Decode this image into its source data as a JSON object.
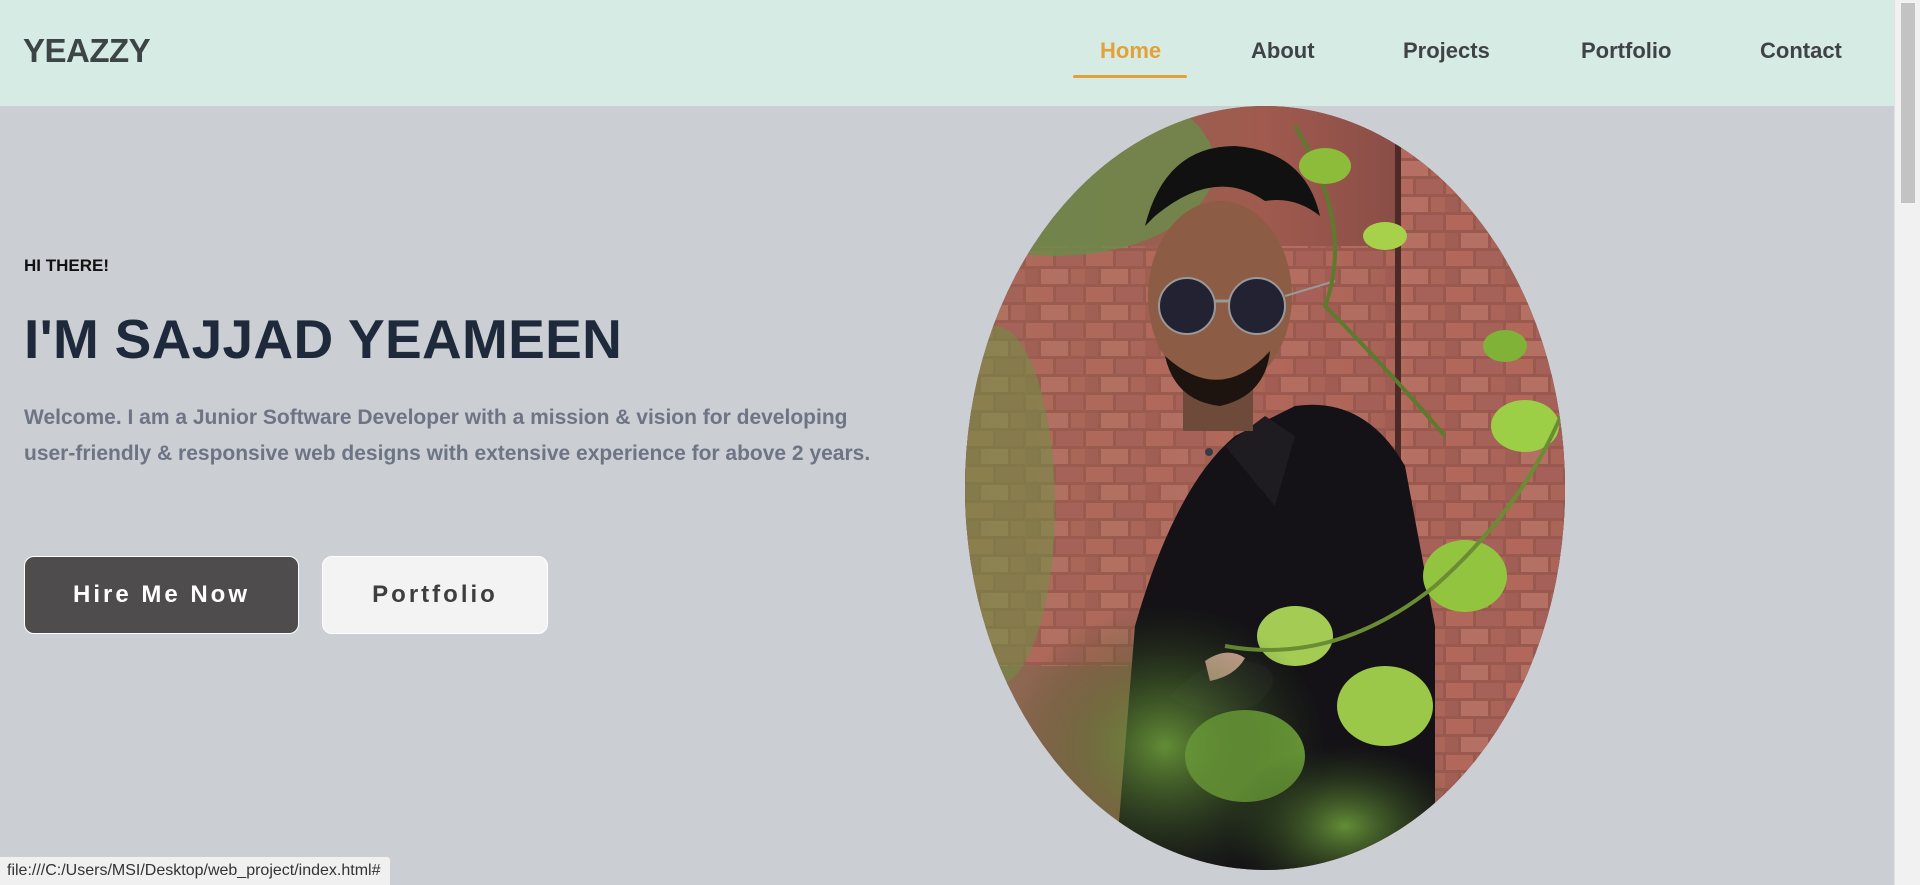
{
  "brand": {
    "logo": "YEAZZY"
  },
  "nav": {
    "items": [
      {
        "label": "Home"
      },
      {
        "label": "About"
      },
      {
        "label": "Projects"
      },
      {
        "label": "Portfolio"
      },
      {
        "label": "Contact"
      }
    ],
    "active_color": "#e2a239"
  },
  "hero": {
    "greeting": "HI THERE!",
    "headline": "I'M SAJJAD YEAMEEN",
    "intro": "Welcome. I am a Junior Software Developer with a mission & vision for developing user-friendly & responsive web designs with extensive experience for above 2 years.",
    "hire_label": "Hire Me Now",
    "portfolio_label": "Portfolio"
  },
  "status": {
    "url": "file:///C:/Users/MSI/Desktop/web_project/index.html#"
  },
  "colors": {
    "navbar_bg": "#d7ebe5",
    "page_bg": "#cbced3",
    "headline": "#1e2a3b",
    "hire_button_bg": "#4e4c4c"
  }
}
